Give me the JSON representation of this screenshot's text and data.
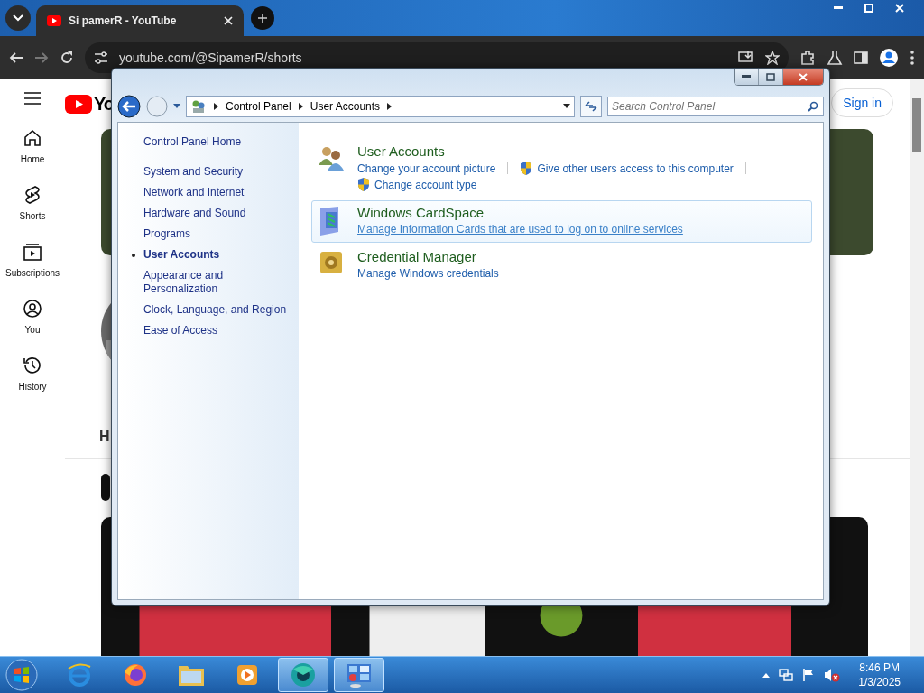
{
  "browser": {
    "tab_title": "Si pamerR - YouTube",
    "url": "youtube.com/@SipamerR/shorts"
  },
  "youtube": {
    "logo_text": "Yo",
    "sign_in": "Sign in",
    "heading": "H",
    "sidebar": [
      {
        "label": "Home",
        "kind": "home"
      },
      {
        "label": "Shorts",
        "kind": "shorts"
      },
      {
        "label": "Subscriptions",
        "kind": "subscriptions"
      },
      {
        "label": "You",
        "kind": "you"
      },
      {
        "label": "History",
        "kind": "history"
      }
    ]
  },
  "control_panel": {
    "breadcrumb": [
      "Control Panel",
      "User Accounts"
    ],
    "search": {
      "placeholder": "Search Control Panel"
    },
    "nav": [
      {
        "label": "Control Panel Home",
        "selected": false
      },
      {
        "label": "System and Security",
        "selected": false
      },
      {
        "label": "Network and Internet",
        "selected": false
      },
      {
        "label": "Hardware and Sound",
        "selected": false
      },
      {
        "label": "Programs",
        "selected": false
      },
      {
        "label": "User Accounts",
        "selected": true
      },
      {
        "label": "Appearance and Personalization",
        "selected": false
      },
      {
        "label": "Clock, Language, and Region",
        "selected": false
      },
      {
        "label": "Ease of Access",
        "selected": false
      }
    ],
    "categories": [
      {
        "title": "User Accounts",
        "kind": "users",
        "hovered": false,
        "link_rows": [
          [
            {
              "text": "Change your account picture",
              "shield": false
            },
            {
              "text": "Give other users access to this computer",
              "shield": true
            }
          ],
          [
            {
              "text": "Change account type",
              "shield": true
            }
          ]
        ]
      },
      {
        "title": "Windows CardSpace",
        "kind": "cardspace",
        "hovered": true,
        "link_rows": [
          [
            {
              "text": "Manage Information Cards that are used to log on to online services",
              "shield": false
            }
          ]
        ]
      },
      {
        "title": "Credential Manager",
        "kind": "vault",
        "hovered": false,
        "link_rows": [
          [
            {
              "text": "Manage Windows credentials",
              "shield": false
            }
          ]
        ]
      }
    ]
  },
  "taskbar": {
    "apps": [
      {
        "kind": "ie",
        "selected": false
      },
      {
        "kind": "firefox",
        "selected": false
      },
      {
        "kind": "folder",
        "selected": false
      },
      {
        "kind": "media",
        "selected": false
      },
      {
        "kind": "chrome",
        "selected": true
      },
      {
        "kind": "controlpanel",
        "selected": true
      }
    ],
    "time": "8:46 PM",
    "date": "1/3/2025"
  }
}
